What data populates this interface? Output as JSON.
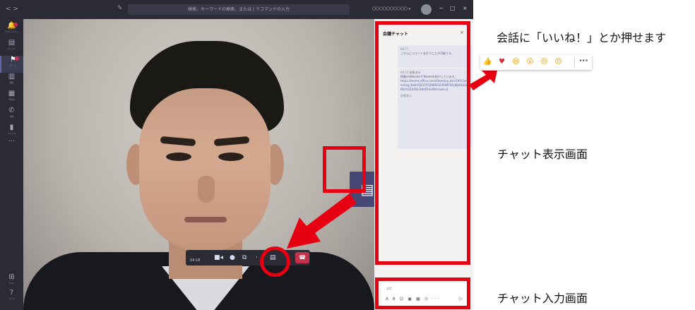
{
  "titlebar": {
    "nav": "< >",
    "edit_icon": "edit-icon",
    "search_placeholder": "検索、キーワードの検索、または / でコマンドの入力",
    "user": "〇〇〇〇〇〇〇〇〇〇 ▾",
    "window_controls": [
      "−",
      "□",
      "×"
    ]
  },
  "rail": {
    "items": [
      {
        "icon": "bell-icon",
        "glyph": "🔔",
        "label": "アクティビティ"
      },
      {
        "icon": "chat-icon",
        "glyph": "▤",
        "label": "チャット"
      },
      {
        "icon": "teams-icon",
        "glyph": "⚑",
        "label": "チーム"
      },
      {
        "icon": "assignment-icon",
        "glyph": "▥",
        "label": "課題"
      },
      {
        "icon": "calendar-icon",
        "glyph": "▦",
        "label": "予定表"
      },
      {
        "icon": "phone-icon",
        "glyph": "✆",
        "label": "通話"
      },
      {
        "icon": "files-icon",
        "glyph": "▮",
        "label": "ファイル"
      },
      {
        "icon": "more-icon",
        "glyph": "···",
        "label": ""
      },
      {
        "icon": "apps-icon",
        "glyph": "⊞",
        "label": "アプリ"
      },
      {
        "icon": "help-icon",
        "glyph": "?",
        "label": "ヘルプ"
      }
    ]
  },
  "callbar": {
    "time": "04:18",
    "camera_icon": "video-camera-icon",
    "mic_icon": "microphone-icon",
    "share_icon": "share-screen-icon",
    "more_icon": "more-icon",
    "chat_icon": "chat-icon",
    "hangup_icon": "hang-up-icon"
  },
  "chat_panel": {
    "title": "会議チャット",
    "close": "×",
    "messages": [
      {
        "time": "09:17",
        "text": "こちらにコメントを打つことが可能です。"
      },
      {
        "time": "09:23 編集済み",
        "text": "授業のWebsiteでTeamsを紹介しています。",
        "link": "https://teams.office.com/l/meetup-join/19%3ameeting_NzE0YjE2OTQtNDE5Zi00MTA4LWJiOGEtZDk0Y2ZjOWU1NzE5%40thread.v2",
        "footer": "詳細表示"
      }
    ],
    "input_placeholder": "返信",
    "tools": "A 𝟎 ☺ ▣ ▦ ◷ ···",
    "send": "▷"
  },
  "reactions": [
    "👍",
    "♥",
    "😆",
    "😮",
    "😢",
    "😠"
  ],
  "reactions_more": "···",
  "annotations": {
    "reactions_note": "会話に「いいね！」とか押せます",
    "chat_display": "チャット表示画面",
    "chat_input": "チャット入力画面"
  },
  "colors": {
    "highlight": "#e60012",
    "teams_purple": "#6264a7",
    "hangup": "#c4314b"
  }
}
